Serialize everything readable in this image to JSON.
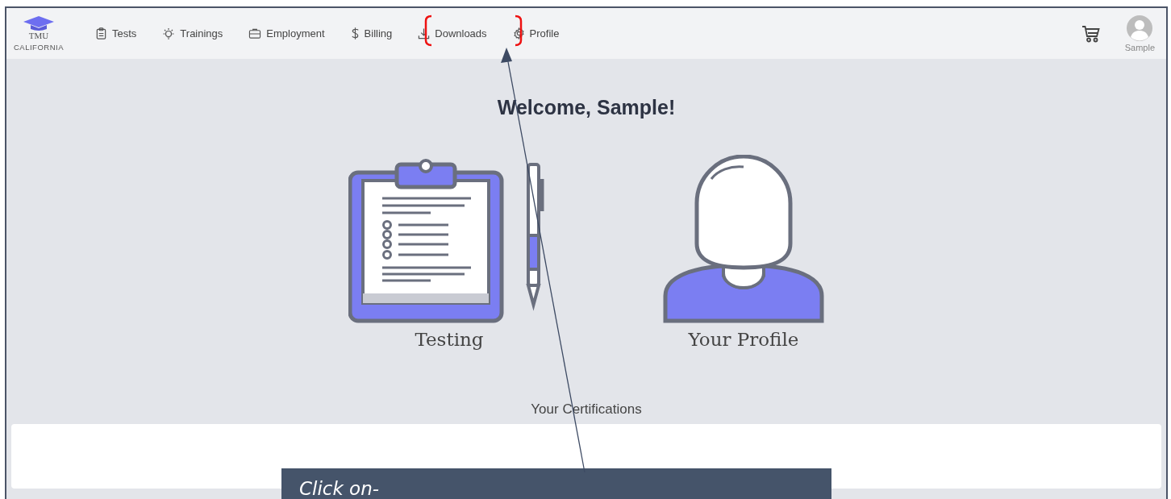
{
  "nav": {
    "logo": {
      "line1": "TMU",
      "line2": "CALIFORNIA"
    },
    "items": [
      {
        "label": "Tests"
      },
      {
        "label": "Trainings"
      },
      {
        "label": "Employment"
      },
      {
        "label": "Billing"
      },
      {
        "label": "Downloads"
      },
      {
        "label": "Profile"
      }
    ],
    "user": {
      "name": "Sample"
    }
  },
  "welcome": "Welcome, Sample!",
  "tiles": [
    {
      "kind": "testing",
      "label": "Testing"
    },
    {
      "kind": "profile",
      "label": "Your Profile"
    }
  ],
  "certifications": {
    "title": "Your Certifications"
  },
  "callout": {
    "text": "Click on-"
  }
}
